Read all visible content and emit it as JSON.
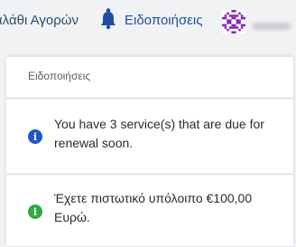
{
  "topbar": {
    "cart_label": "αλάθι Αγορών",
    "notifications_label": "Ειδοποιήσεις"
  },
  "panel": {
    "title": "Ειδοποιήσεις",
    "items": [
      {
        "icon": "info-icon",
        "color": "#1f58c4",
        "text": "You have 3 service(s) that are due for renewal soon."
      },
      {
        "icon": "info-icon",
        "color": "#2eab45",
        "text": "Έχετε πιστωτικό υπόλοιπο €100,00 Ευρώ."
      }
    ]
  }
}
